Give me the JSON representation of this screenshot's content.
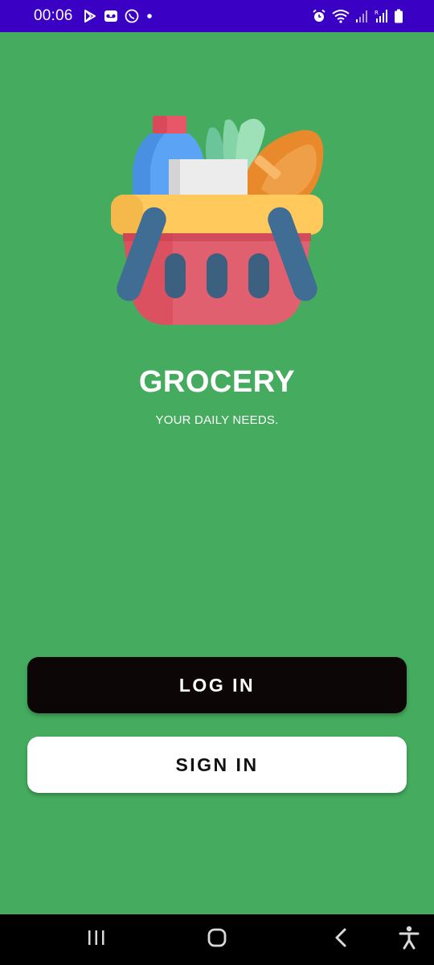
{
  "status_bar": {
    "time": "00:06",
    "left_icons": [
      "play-store-icon",
      "voicemail-icon",
      "call-icon",
      "dot-icon"
    ],
    "right_icons": [
      "alarm-icon",
      "wifi-icon",
      "signal-icon",
      "signal-r-icon",
      "battery-icon"
    ],
    "background": "#3a00c4"
  },
  "app": {
    "title": "GROCERY",
    "subtitle": "YOUR DAILY NEEDS.",
    "background": "#45ab5e",
    "logo": "grocery-basket-icon"
  },
  "actions": {
    "login_label": "LOG IN",
    "signin_label": "SIGN IN"
  },
  "nav_bar": {
    "items": [
      "recents-icon",
      "home-icon",
      "back-icon",
      "accessibility-icon"
    ]
  }
}
